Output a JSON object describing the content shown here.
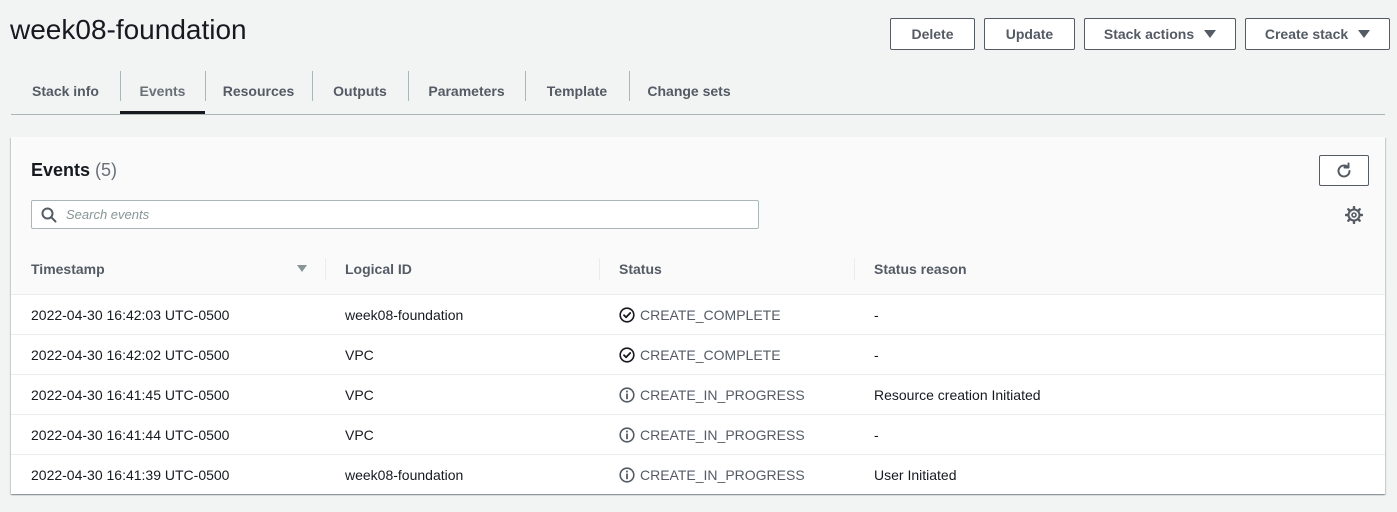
{
  "page": {
    "title": "week08-foundation"
  },
  "actions": {
    "delete_label": "Delete",
    "update_label": "Update",
    "stack_actions_label": "Stack actions",
    "create_stack_label": "Create stack"
  },
  "tabs": [
    {
      "label": "Stack info",
      "active": false
    },
    {
      "label": "Events",
      "active": true
    },
    {
      "label": "Resources",
      "active": false
    },
    {
      "label": "Outputs",
      "active": false
    },
    {
      "label": "Parameters",
      "active": false
    },
    {
      "label": "Template",
      "active": false
    },
    {
      "label": "Change sets",
      "active": false
    }
  ],
  "events": {
    "title": "Events",
    "count": "(5)",
    "search_placeholder": "Search events",
    "columns": {
      "timestamp": "Timestamp",
      "logical_id": "Logical ID",
      "status": "Status",
      "status_reason": "Status reason"
    },
    "rows": [
      {
        "timestamp": "2022-04-30 16:42:03 UTC-0500",
        "logical_id": "week08-foundation",
        "status": "CREATE_COMPLETE",
        "status_icon": "check-circle-icon",
        "reason": "-"
      },
      {
        "timestamp": "2022-04-30 16:42:02 UTC-0500",
        "logical_id": "VPC",
        "status": "CREATE_COMPLETE",
        "status_icon": "check-circle-icon",
        "reason": "-"
      },
      {
        "timestamp": "2022-04-30 16:41:45 UTC-0500",
        "logical_id": "VPC",
        "status": "CREATE_IN_PROGRESS",
        "status_icon": "info-circle-icon",
        "reason": "Resource creation Initiated"
      },
      {
        "timestamp": "2022-04-30 16:41:44 UTC-0500",
        "logical_id": "VPC",
        "status": "CREATE_IN_PROGRESS",
        "status_icon": "info-circle-icon",
        "reason": "-"
      },
      {
        "timestamp": "2022-04-30 16:41:39 UTC-0500",
        "logical_id": "week08-foundation",
        "status": "CREATE_IN_PROGRESS",
        "status_icon": "info-circle-icon",
        "reason": "User Initiated"
      }
    ]
  },
  "colors": {
    "text": "#16191f",
    "muted": "#545b64",
    "border": "#eaeded",
    "background": "#f2f3f3"
  }
}
